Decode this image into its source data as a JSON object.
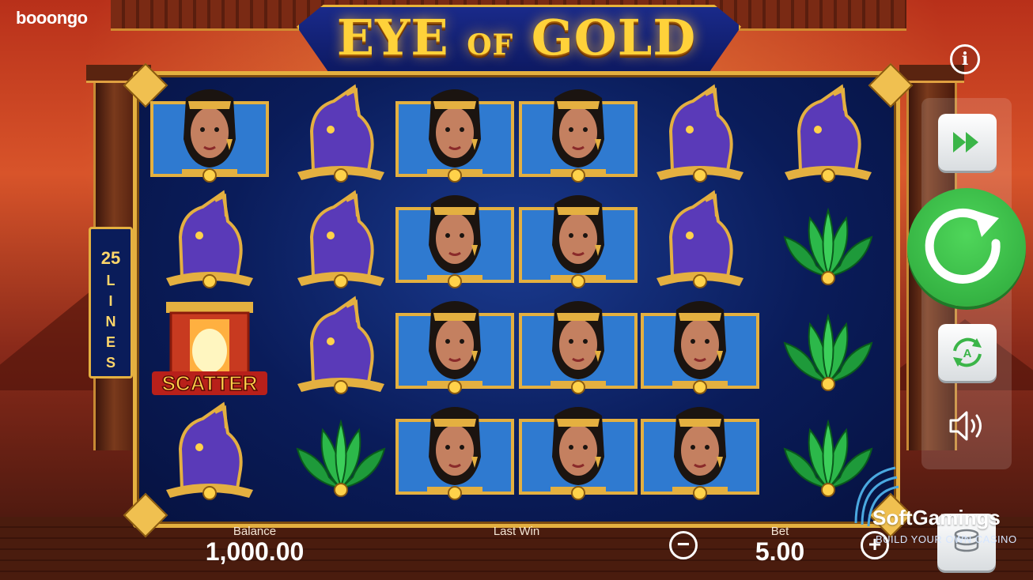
{
  "brand": {
    "logo_text": "booongo"
  },
  "game": {
    "title_left": "EYE",
    "title_mid": "OF",
    "title_right": "GOLD"
  },
  "lines_badge": {
    "number": "25",
    "word_letters": [
      "L",
      "I",
      "N",
      "E",
      "S"
    ]
  },
  "info_button": {
    "label": "i"
  },
  "symbols": {
    "scatter_label": "SCATTER",
    "grid": [
      [
        "queen",
        "cat",
        "queen",
        "queen",
        "cat",
        "cat"
      ],
      [
        "cat",
        "cat",
        "queen",
        "queen",
        "cat",
        "lotus"
      ],
      [
        "scatter",
        "cat",
        "queen",
        "queen",
        "queen",
        "lotus"
      ],
      [
        "cat",
        "lotus",
        "queen",
        "queen",
        "queen",
        "lotus"
      ]
    ]
  },
  "controls": {
    "turbo_icon": "fast-forward-icon",
    "spin_icon": "spin-arrow-icon",
    "autoplay_icon": "autoplay-icon",
    "autoplay_letter": "A",
    "sound_icon": "speaker-icon",
    "coins_icon": "coins-stack-icon"
  },
  "footer": {
    "balance_label": "Balance",
    "balance_value": "1,000.00",
    "last_win_label": "Last Win",
    "bet_label": "Bet",
    "bet_value": "5.00",
    "minus": "−",
    "plus": "+"
  },
  "watermark": {
    "name": "SoftGamings",
    "tagline": "BUILD YOUR OWN CASINO"
  },
  "colors": {
    "gold": "#e4b040",
    "reel_bg": "#0a1c5a",
    "spin_green": "#2ba63a",
    "cat_purple": "#5a3ab8",
    "lotus_green": "#1e9a3a"
  }
}
